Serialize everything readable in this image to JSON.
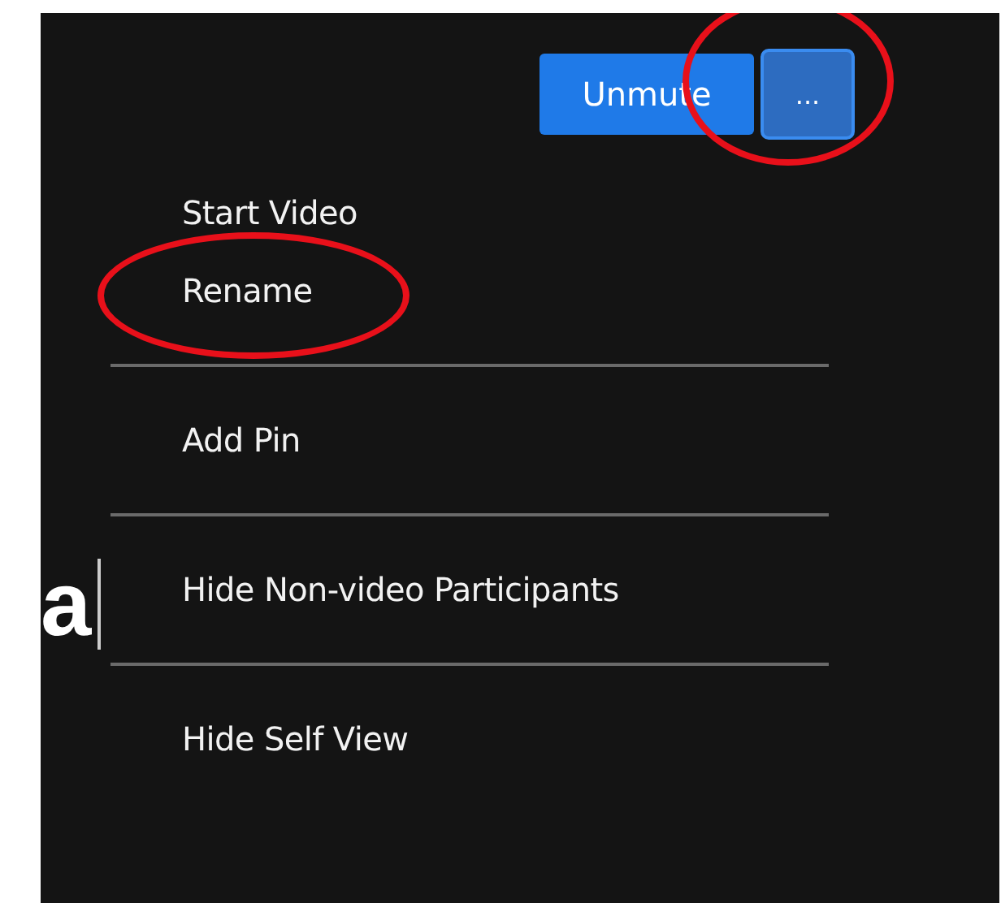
{
  "controls": [
    {
      "kind": "unmute",
      "label": "Unmute",
      "circled": false
    },
    {
      "kind": "more",
      "label": "...",
      "circled": true
    }
  ],
  "menu_groups": [
    [
      {
        "label": "Start Video",
        "circled": false
      },
      {
        "label": "Rename",
        "circled": true
      }
    ],
    [
      {
        "label": "Add Pin",
        "circled": false
      }
    ],
    [
      {
        "label": "Hide Non-video Participants",
        "circled": false
      }
    ],
    [
      {
        "label": "Hide Self View",
        "circled": false
      }
    ]
  ],
  "name_fragment": "a"
}
